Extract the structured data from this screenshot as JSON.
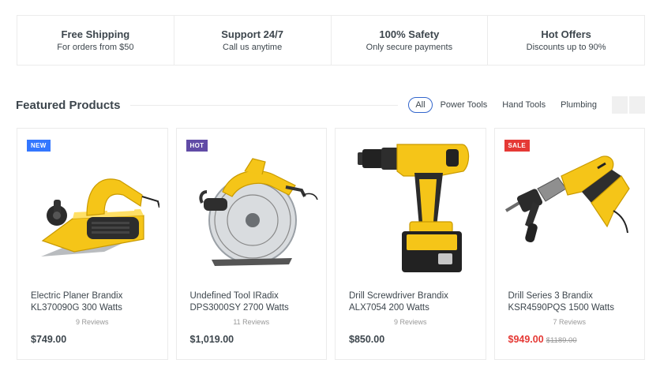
{
  "features": [
    {
      "title": "Free Shipping",
      "subtitle": "For orders from $50"
    },
    {
      "title": "Support 24/7",
      "subtitle": "Call us anytime"
    },
    {
      "title": "100% Safety",
      "subtitle": "Only secure payments"
    },
    {
      "title": "Hot Offers",
      "subtitle": "Discounts up to 90%"
    }
  ],
  "section": {
    "title": "Featured Products",
    "tabs": [
      "All",
      "Power Tools",
      "Hand Tools",
      "Plumbing"
    ],
    "active_tab": "All"
  },
  "products": [
    {
      "badge": "NEW",
      "badge_color": "#3377ff",
      "name": "Electric Planer Brandix KL370090G 300 Watts",
      "reviews": "9 Reviews",
      "price": "$749.00",
      "old_price": "",
      "image_icon": "electric-planer-icon"
    },
    {
      "badge": "HOT",
      "badge_color": "#614ba6",
      "name": "Undefined Tool IRadix DPS3000SY 2700 Watts",
      "reviews": "11 Reviews",
      "price": "$1,019.00",
      "old_price": "",
      "image_icon": "circular-saw-icon"
    },
    {
      "badge": "",
      "badge_color": "",
      "name": "Drill Screwdriver Brandix ALX7054 200 Watts",
      "reviews": "9 Reviews",
      "price": "$850.00",
      "old_price": "",
      "image_icon": "drill-screwdriver-icon"
    },
    {
      "badge": "SALE",
      "badge_color": "#e53935",
      "name": "Drill Series 3 Brandix KSR4590PQS 1500 Watts",
      "reviews": "7 Reviews",
      "price": "$949.00",
      "old_price": "$1189.00",
      "image_icon": "hammer-drill-icon"
    }
  ],
  "colors": {
    "accent": "#3366cc",
    "sale": "#e53935",
    "tool_yellow": "#f5c518"
  }
}
